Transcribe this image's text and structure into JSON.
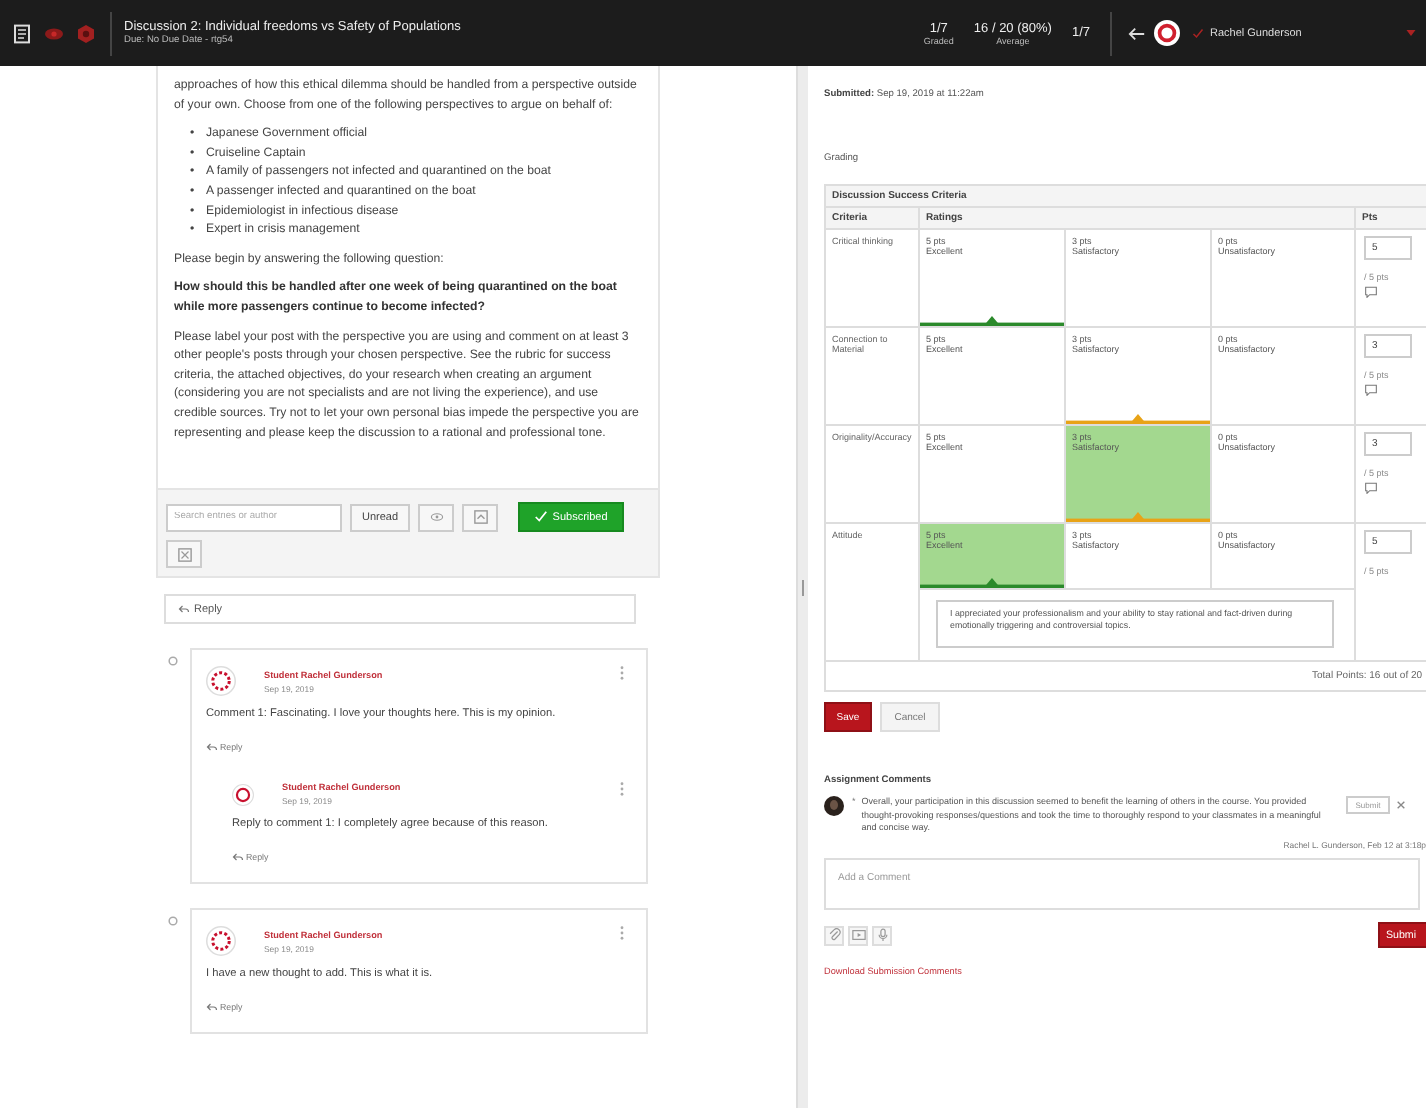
{
  "header": {
    "title": "Discussion 2: Individual freedoms vs Safety of Populations",
    "subtitle": "Due: No Due Date - rtg54",
    "stats": [
      {
        "value": "1/7",
        "label": "Graded"
      },
      {
        "value": "16 / 20 (80%)",
        "label": "Average"
      }
    ],
    "position": "1/7",
    "student": "Rachel Gunderson"
  },
  "prompt": {
    "intro": "approaches of how this ethical dilemma should be handled from a perspective outside of your own. Choose from one of the following perspectives to argue on behalf of:",
    "perspectives": [
      {
        "bullet": "•",
        "text": "Japanese Government official"
      },
      {
        "bullet": "•",
        "text": "Cruiseline Captain"
      },
      {
        "bullet": "•",
        "text": "A family of passengers not infected and quarantined on the boat"
      },
      {
        "bullet": "•",
        "text": "A passenger infected and quarantined on the boat"
      },
      {
        "bullet": "•",
        "text": "Epidemiologist in infectious disease"
      },
      {
        "bullet": "•",
        "text": "Expert in crisis management"
      }
    ],
    "instruction": "Please begin by answering the following question:",
    "question": "How should this be handled after one week of being quarantined on the boat while more passengers continue to become infected?",
    "details": "Please label your post with the perspective you are using and comment on at least 3 other people's posts through your chosen perspective. See the rubric for success criteria, the attached objectives, do your research when creating an argument (considering you are not specialists and are not living the experience), and use credible sources. Try not to let your own personal bias impede the perspective you are representing and please keep the discussion to a rational and professional tone."
  },
  "toolbar": {
    "search_placeholder": "Search entries or author",
    "unread": "Unread",
    "subscribed": "Subscribed"
  },
  "reply_label": "Reply",
  "posts": [
    {
      "author": "Student Rachel Gunderson",
      "date": "Sep 19, 2019",
      "body": "Comment 1: Fascinating.  I love your thoughts here. This is my opinion.",
      "reply": "Reply",
      "children": [
        {
          "author": "Student Rachel Gunderson",
          "date": "Sep 19, 2019",
          "body": "Reply to comment 1: I completely agree because of this reason.",
          "reply": "Reply"
        }
      ]
    },
    {
      "author": "Student Rachel Gunderson",
      "date": "Sep 19, 2019",
      "body": "I have a new thought to add. This is what it is.",
      "reply": "Reply"
    }
  ],
  "submitted": {
    "label": "Submitted:",
    "value": "Sep 19, 2019 at 11:22am"
  },
  "grading_label": "Grading",
  "rubric": {
    "title": "Discussion Success Criteria",
    "columns": [
      "Criteria",
      "Ratings",
      "Pts"
    ],
    "criteria": [
      {
        "name": "Critical thinking",
        "color": "#2b8a2b",
        "score": "5",
        "out_of": "/ 5 pts",
        "comment_button": true,
        "ratings": [
          {
            "points": "5 pts",
            "label": "Excellent",
            "selected": false,
            "marked": true
          },
          {
            "points": "3 pts",
            "label": "Satisfactory",
            "selected": false,
            "marked": false
          },
          {
            "points": "0 pts",
            "label": "Unsatisfactory",
            "selected": false,
            "marked": false
          }
        ]
      },
      {
        "name": "Connection to Material",
        "color": "#e8a317",
        "score": "3",
        "out_of": "/ 5 pts",
        "comment_button": true,
        "ratings": [
          {
            "points": "5 pts",
            "label": "Excellent",
            "selected": false,
            "marked": false
          },
          {
            "points": "3 pts",
            "label": "Satisfactory",
            "selected": false,
            "marked": true
          },
          {
            "points": "0 pts",
            "label": "Unsatisfactory",
            "selected": false,
            "marked": false
          }
        ]
      },
      {
        "name": "Originality/Accuracy",
        "color": "#e8a317",
        "score": "3",
        "out_of": "/ 5 pts",
        "comment_button": true,
        "ratings": [
          {
            "points": "5 pts",
            "label": "Excellent",
            "selected": false,
            "marked": false
          },
          {
            "points": "3 pts",
            "label": "Satisfactory",
            "selected": true,
            "marked": true
          },
          {
            "points": "0 pts",
            "label": "Unsatisfactory",
            "selected": false,
            "marked": false
          }
        ]
      },
      {
        "name": "Attitude",
        "color": "#2b8a2b",
        "score": "5",
        "out_of": "/ 5 pts",
        "comment_button": false,
        "comment": "I appreciated your professionalism and your ability to stay rational and fact-driven during emotionally triggering and controversial topics.",
        "ratings": [
          {
            "points": "5 pts",
            "label": "Excellent",
            "selected": true,
            "marked": true
          },
          {
            "points": "3 pts",
            "label": "Satisfactory",
            "selected": false,
            "marked": false
          },
          {
            "points": "0 pts",
            "label": "Unsatisfactory",
            "selected": false,
            "marked": false
          }
        ]
      }
    ],
    "total": "Total Points: 16 out of 20"
  },
  "save": "Save",
  "cancel": "Cancel",
  "comments": {
    "title": "Assignment Comments",
    "items": [
      {
        "marker": "*",
        "text": "Overall, your participation in this discussion seemed to benefit the learning of others in the course. You provided thought-provoking responses/questions and took the time to thoroughly respond to your classmates in a meaningful and concise way.",
        "action": "Submit",
        "author": "Rachel L. Gunderson, Feb 12 at 3:18p"
      }
    ],
    "placeholder": "Add a Comment",
    "submit": "Submi",
    "download": "Download Submission Comments"
  }
}
